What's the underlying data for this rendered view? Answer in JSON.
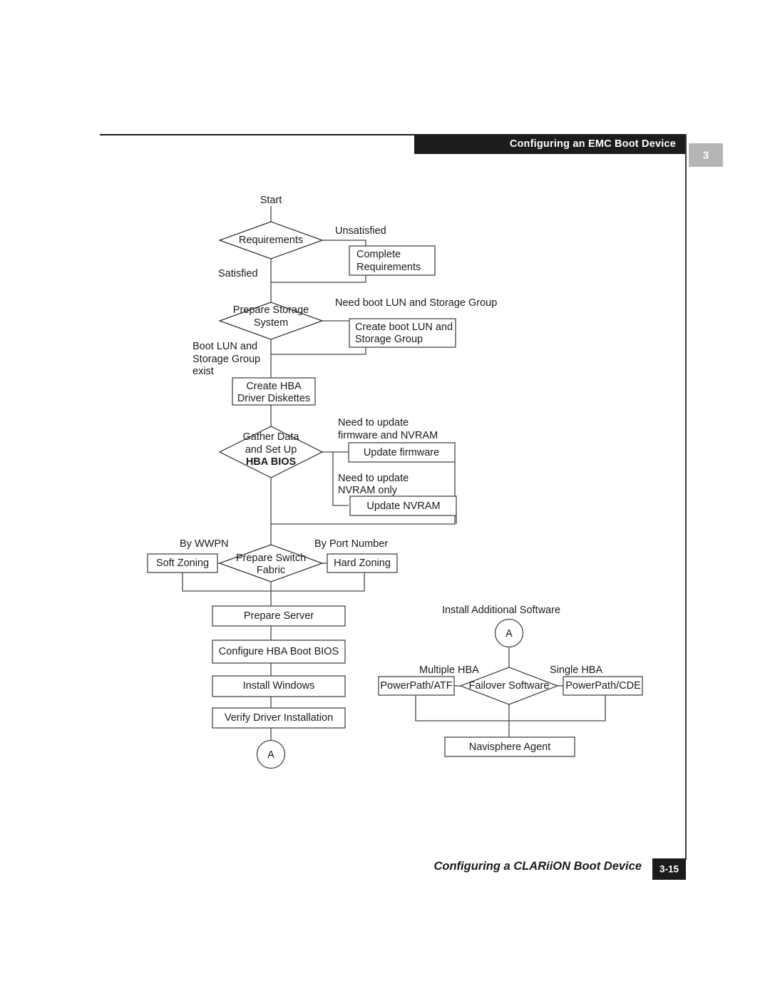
{
  "header": {
    "title": "Configuring an EMC Boot Device",
    "chapter_number": "3"
  },
  "footer": {
    "title": "Configuring a CLARiiON Boot Device",
    "page_number": "3-15"
  },
  "diagram": {
    "type": "flowchart",
    "title": "Configuring a CLARiiON Boot Device",
    "nodes": {
      "start": {
        "label": "Start",
        "shape": "text"
      },
      "requirements": {
        "label": "Requirements",
        "shape": "diamond"
      },
      "complete_requirements": {
        "label_line1": "Complete",
        "label_line2": "Requirements",
        "shape": "process"
      },
      "prepare_storage_system": {
        "label_line1": "Prepare Storage",
        "label_line2": "System",
        "shape": "diamond"
      },
      "create_boot_lun": {
        "label_line1": "Create boot LUN and",
        "label_line2": "Storage Group",
        "shape": "process"
      },
      "create_hba_diskettes": {
        "label_line1": "Create HBA",
        "label_line2": "Driver Diskettes",
        "shape": "process"
      },
      "gather_data": {
        "label_line1": "Gather Data",
        "label_line2": "and Set Up",
        "label_line3": "HBA BIOS",
        "shape": "diamond"
      },
      "update_firmware": {
        "label": "Update firmware",
        "shape": "process"
      },
      "update_nvram": {
        "label": "Update NVRAM",
        "shape": "process"
      },
      "prepare_switch_fabric": {
        "label_line1": "Prepare Switch",
        "label_line2": "Fabric",
        "shape": "diamond"
      },
      "soft_zoning": {
        "label": "Soft Zoning",
        "shape": "process"
      },
      "hard_zoning": {
        "label": "Hard Zoning",
        "shape": "process"
      },
      "prepare_server": {
        "label": "Prepare Server",
        "shape": "process"
      },
      "configure_hba_boot_bios": {
        "label": "Configure HBA Boot BIOS",
        "shape": "process"
      },
      "install_windows": {
        "label": "Install Windows",
        "shape": "process"
      },
      "verify_driver_installation": {
        "label": "Verify Driver Installation",
        "shape": "process"
      },
      "connector_a_left": {
        "label": "A",
        "shape": "circle"
      },
      "install_additional_software": {
        "label": "Install Additional Software",
        "shape": "text"
      },
      "connector_a_right": {
        "label": "A",
        "shape": "circle"
      },
      "failover_software": {
        "label": "Failover Software",
        "shape": "diamond"
      },
      "powerpath_atf": {
        "label": "PowerPath/ATF",
        "shape": "process"
      },
      "powerpath_cde": {
        "label": "PowerPath/CDE",
        "shape": "process"
      },
      "navisphere_agent": {
        "label": "Navisphere Agent",
        "shape": "process"
      }
    },
    "edge_labels": {
      "unsatisfied": "Unsatisfied",
      "satisfied": "Satisfied",
      "need_boot_lun": "Need boot LUN and Storage Group",
      "boot_lun_exists_line1": "Boot LUN and",
      "boot_lun_exists_line2": "Storage Group",
      "boot_lun_exists_line3": "exist",
      "need_update_fw_line1": "Need to update",
      "need_update_fw_line2": "firmware and NVRAM",
      "need_update_nvram_line1": "Need to update",
      "need_update_nvram_line2": "NVRAM only",
      "by_wwpn": "By WWPN",
      "by_port_number": "By Port Number",
      "multiple_hba": "Multiple HBA",
      "single_hba": "Single HBA"
    }
  }
}
